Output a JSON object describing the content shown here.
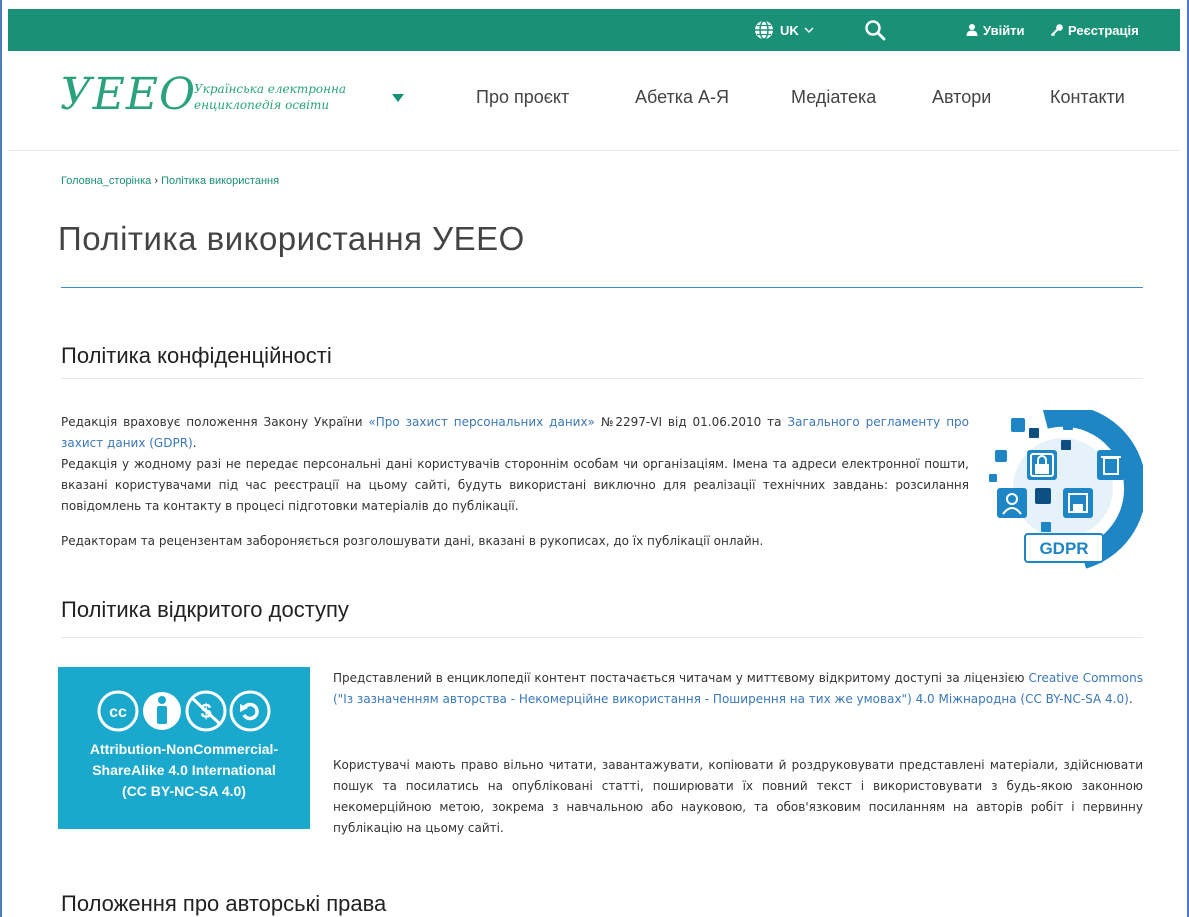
{
  "topbar": {
    "lang": "UK",
    "login": "Увійти",
    "register": "Реєстрація"
  },
  "header": {
    "logo_mark": "УЕЕО",
    "logo_line1": "Українська електронна",
    "logo_line2": "енциклопедія освіти",
    "nav": [
      "Про проєкт",
      "Абетка А-Я",
      "Медіатека",
      "Автори",
      "Контакти"
    ]
  },
  "breadcrumb": {
    "home": "Головна_сторінка",
    "separator": "›",
    "current": "Політика використання"
  },
  "page_title": "Політика використання УЕЕО",
  "privacy": {
    "heading": "Політика конфіденційності",
    "p1_a": "Редакція враховує положення Закону України ",
    "p1_link1": "«Про захист персональних даних»",
    "p1_b": " №2297-VI від 01.06.2010 та ",
    "p1_link2": "Загального регламенту про захист даних (GDPR)",
    "p1_c": ".",
    "p2": "Редакція у жодному разі не передає персональні дані користувачів стороннім особам чи організаціям. Імена та адреси електронної пошти, вказані користувачами під час реєстрації на цьому сайті, будуть використані виключно для реалізації технічних завдань: розсилання повідомлень та контакту в процесі підготовки матеріалів до публікації.",
    "p3": "Редакторам та рецензентам забороняється розголошувати дані, вказані в рукописах, до їх публікації онлайн.",
    "gdpr_label": "GDPR"
  },
  "open_access": {
    "heading": "Політика відкритого доступу",
    "cc_line1": "Attribution-NonCommercial-",
    "cc_line2": "ShareAlike 4.0 International",
    "cc_line3": "(CC BY-NC-SA 4.0)",
    "p1_a": "Представлений в енциклопедії контент постачається читачам у миттєвому відкритому доступі за ліцензією ",
    "p1_link": "Creative Commons (\"Із зазначенням авторства - Некомерційне використання - Поширення на тих же умовах\") 4.0 Міжнародна (CC BY-NC-SA 4.0)",
    "p1_c": ".",
    "p2": "Користувачі мають право вільно читати, завантажувати, копіювати й роздруковувати представлені матеріали, здійснювати пошук та посилатись на опубліковані статті, поширювати їх повний текст і використовувати з будь-якою законною некомерційною метою, зокрема з навчальною або науковою, та обов'язковим посиланням на авторів робіт і первинну публікацію на цьому сайті."
  },
  "copyright": {
    "heading": "Положення про авторські права"
  },
  "colors": {
    "topbar": "#1a9077",
    "logo": "#2aa27d",
    "link": "#3b78b8",
    "title_rule": "#3a8fc6",
    "cc_box": "#1aa8cc",
    "gdpr": "#1e86c4"
  },
  "icons": [
    "globe-icon",
    "chevron-down-icon",
    "search-icon",
    "user-icon",
    "key-icon",
    "dropdown-triangle-icon",
    "gdpr-illustration",
    "cc-icon",
    "by-icon",
    "nc-icon",
    "sa-icon"
  ]
}
